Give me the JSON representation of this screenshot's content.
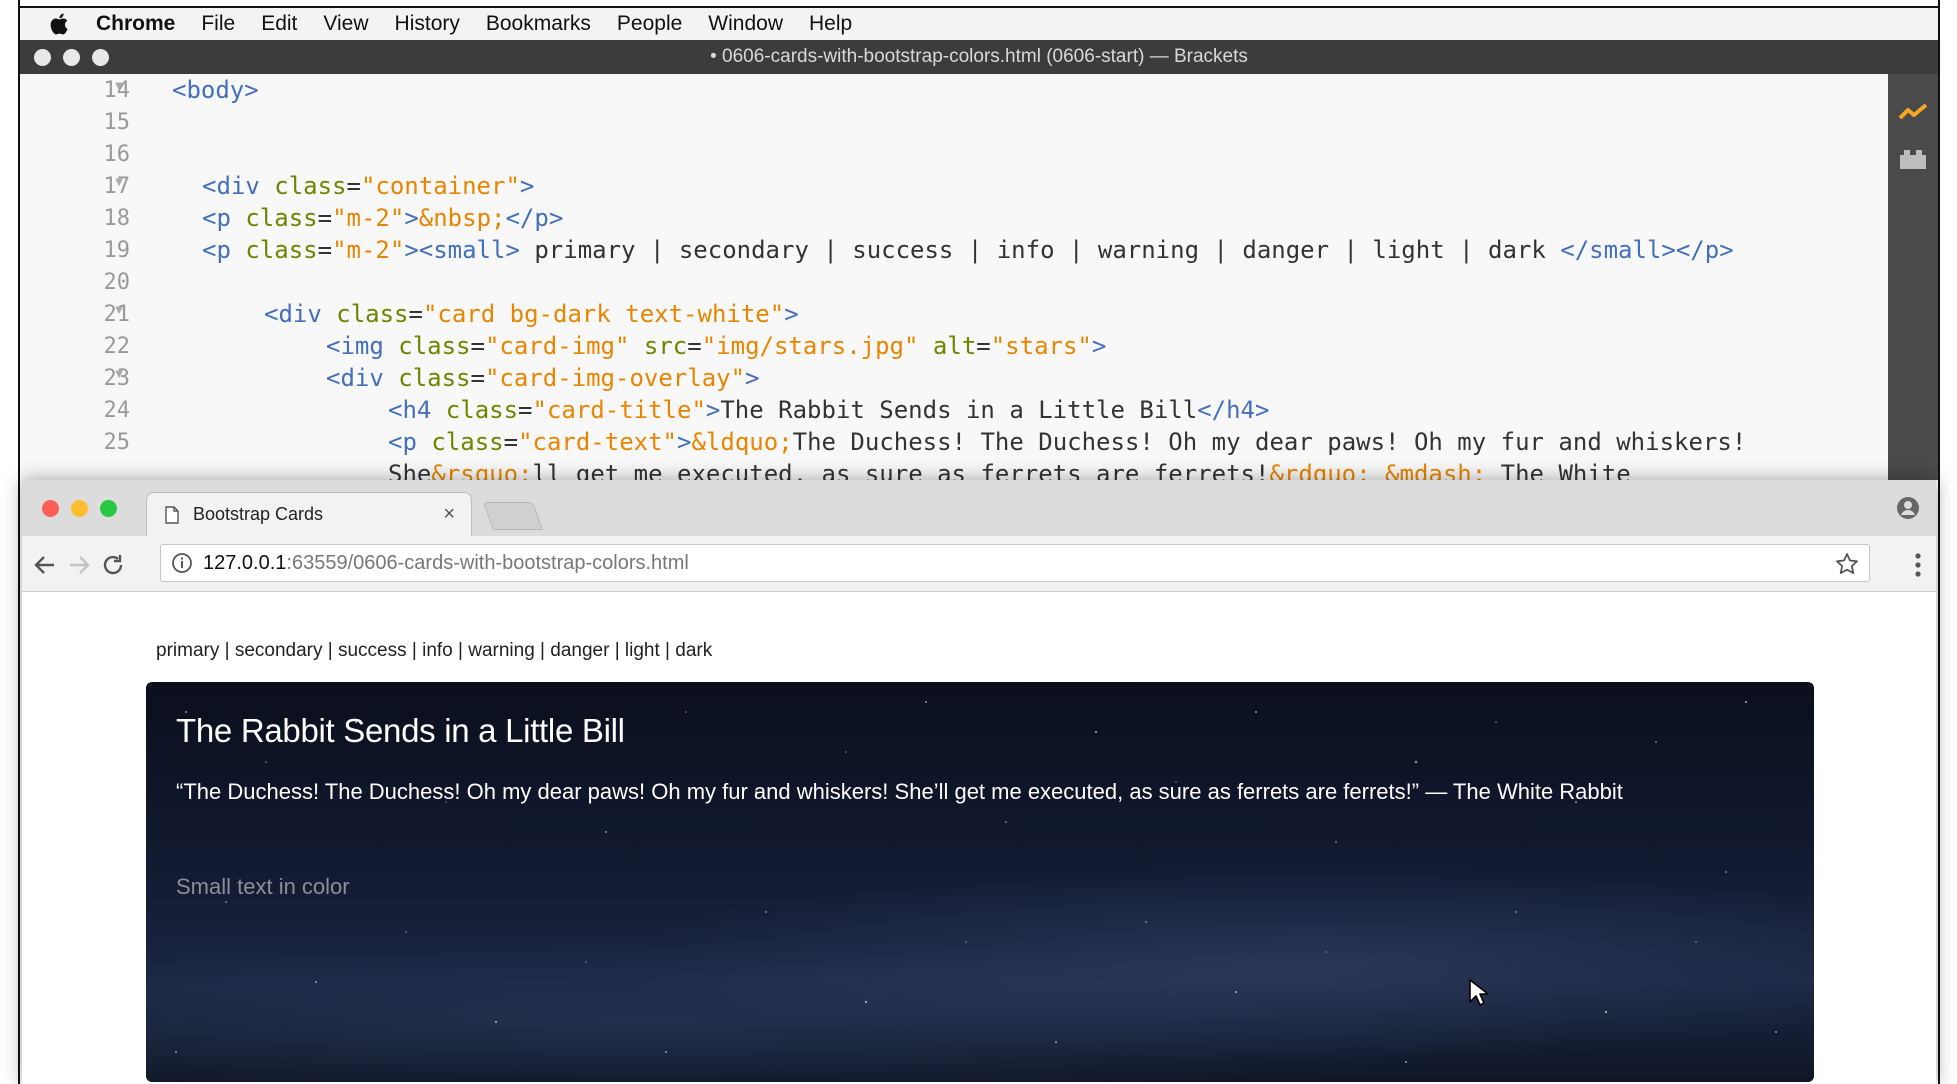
{
  "menubar": {
    "app": "Chrome",
    "items": [
      "File",
      "Edit",
      "View",
      "History",
      "Bookmarks",
      "People",
      "Window",
      "Help"
    ]
  },
  "brackets": {
    "title": "• 0606-cards-with-bootstrap-colors.html (0606-start) — Brackets",
    "lines": [
      {
        "n": "14",
        "fold": true
      },
      {
        "n": "15",
        "fold": false
      },
      {
        "n": "16",
        "fold": false
      },
      {
        "n": "17",
        "fold": true
      },
      {
        "n": "18",
        "fold": false
      },
      {
        "n": "19",
        "fold": false
      },
      {
        "n": "20",
        "fold": false
      },
      {
        "n": "21",
        "fold": true
      },
      {
        "n": "22",
        "fold": false
      },
      {
        "n": "23",
        "fold": true
      },
      {
        "n": "24",
        "fold": false
      },
      {
        "n": "25",
        "fold": false
      }
    ],
    "code": {
      "l14_tag": "<body>",
      "l17_open": "<div ",
      "l17_attr": "class",
      "l17_val": "\"container\"",
      "l17_close": ">",
      "l18_open": "<p ",
      "l18_attr": "class",
      "l18_val": "\"m-2\"",
      "l18_close": ">",
      "l18_ent": "&nbsp;",
      "l18_end": "</p>",
      "l19_open": "<p ",
      "l19_attr": "class",
      "l19_val": "\"m-2\"",
      "l19_close": "><small>",
      "l19_text": " primary | secondary | success | info | warning | danger | light | dark ",
      "l19_end": "</small></p>",
      "l21_open": "<div ",
      "l21_attr": "class",
      "l21_val": "\"card bg-dark text-white\"",
      "l21_close": ">",
      "l22_open": "<img ",
      "l22_attr1": "class",
      "l22_val1": "\"card-img\"",
      "l22_attr2": "src",
      "l22_val2": "\"img/stars.jpg\"",
      "l22_attr3": "alt",
      "l22_val3": "\"stars\"",
      "l22_close": ">",
      "l23_open": "<div ",
      "l23_attr": "class",
      "l23_val": "\"card-img-overlay\"",
      "l23_close": ">",
      "l24_open": "<h4 ",
      "l24_attr": "class",
      "l24_val": "\"card-title\"",
      "l24_close": ">",
      "l24_text": "The Rabbit Sends in a Little Bill",
      "l24_end": "</h4>",
      "l25_open": "<p ",
      "l25_attr": "class",
      "l25_val": "\"card-text\"",
      "l25_close": ">",
      "l25_ent": "&ldquo;",
      "l25_text": "The Duchess! The Duchess! Oh my dear paws! Oh my fur and whiskers!",
      "l26_a": "She",
      "l26_ent1": "&rsquo;",
      "l26_b": "ll get me executed, as sure as ferrets are ferrets!",
      "l26_ent2": "&rdquo;",
      "l26_sp": " ",
      "l26_ent3": "&mdash;",
      "l26_c": " The White"
    }
  },
  "chrome": {
    "tab_title": "Bootstrap Cards",
    "tab_close": "×",
    "url_host": "127.0.0.1",
    "url_rest": ":63559/0606-cards-with-bootstrap-colors.html"
  },
  "page": {
    "color_line": "primary | secondary | success | info | warning | danger | light | dark",
    "card_title": "The Rabbit Sends in a Little Bill",
    "card_text": "“The Duchess! The Duchess! Oh my dear paws! Oh my fur and whiskers! She’ll get me executed, as sure as ferrets are ferrets!” — The White Rabbit",
    "card_small": "Small text in color"
  },
  "colors": {
    "brackets_tag": "#446fbd",
    "brackets_attr": "#6d8600",
    "brackets_string": "#e88501",
    "accent_icon": "#f5a623"
  },
  "icons": [
    "apple-icon",
    "fold-arrow-icon",
    "live-preview-icon",
    "extension-manager-icon",
    "document-icon",
    "close-icon",
    "profile-icon",
    "back-icon",
    "forward-icon",
    "reload-icon",
    "info-icon",
    "bookmark-star-icon",
    "chrome-menu-icon",
    "mouse-cursor-icon"
  ]
}
